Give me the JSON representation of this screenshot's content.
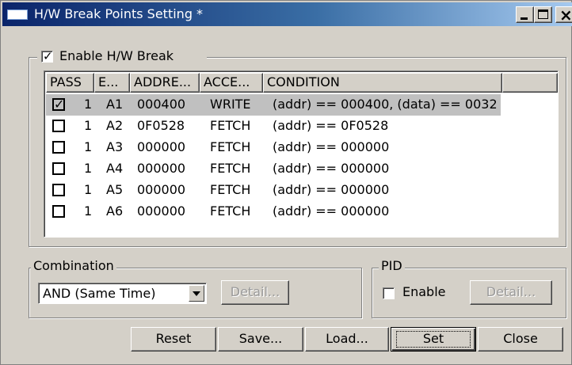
{
  "window": {
    "title": "H/W Break Points Setting *"
  },
  "enable_group": {
    "label": "Enable H/W Break",
    "checked": true
  },
  "list": {
    "columns": [
      "PASS",
      "E...",
      "ADDRE...",
      "ACCE...",
      "CONDITION"
    ],
    "rows": [
      {
        "checked": true,
        "pass": "1",
        "e": "A1",
        "address": "000400",
        "access": "WRITE",
        "condition": "(addr) == 000400, (data) == 0032"
      },
      {
        "checked": false,
        "pass": "1",
        "e": "A2",
        "address": "0F0528",
        "access": "FETCH",
        "condition": "(addr) == 0F0528"
      },
      {
        "checked": false,
        "pass": "1",
        "e": "A3",
        "address": "000000",
        "access": "FETCH",
        "condition": "(addr) == 000000"
      },
      {
        "checked": false,
        "pass": "1",
        "e": "A4",
        "address": "000000",
        "access": "FETCH",
        "condition": "(addr) == 000000"
      },
      {
        "checked": false,
        "pass": "1",
        "e": "A5",
        "address": "000000",
        "access": "FETCH",
        "condition": "(addr) == 000000"
      },
      {
        "checked": false,
        "pass": "1",
        "e": "A6",
        "address": "000000",
        "access": "FETCH",
        "condition": "(addr) == 000000"
      }
    ]
  },
  "combination": {
    "label": "Combination",
    "selected": "AND (Same Time)",
    "detail_label": "Detail..."
  },
  "pid": {
    "label": "PID",
    "enable_label": "Enable",
    "enable_checked": false,
    "detail_label": "Detail..."
  },
  "buttons": {
    "reset": "Reset",
    "save": "Save...",
    "load": "Load...",
    "set": "Set",
    "close": "Close"
  }
}
